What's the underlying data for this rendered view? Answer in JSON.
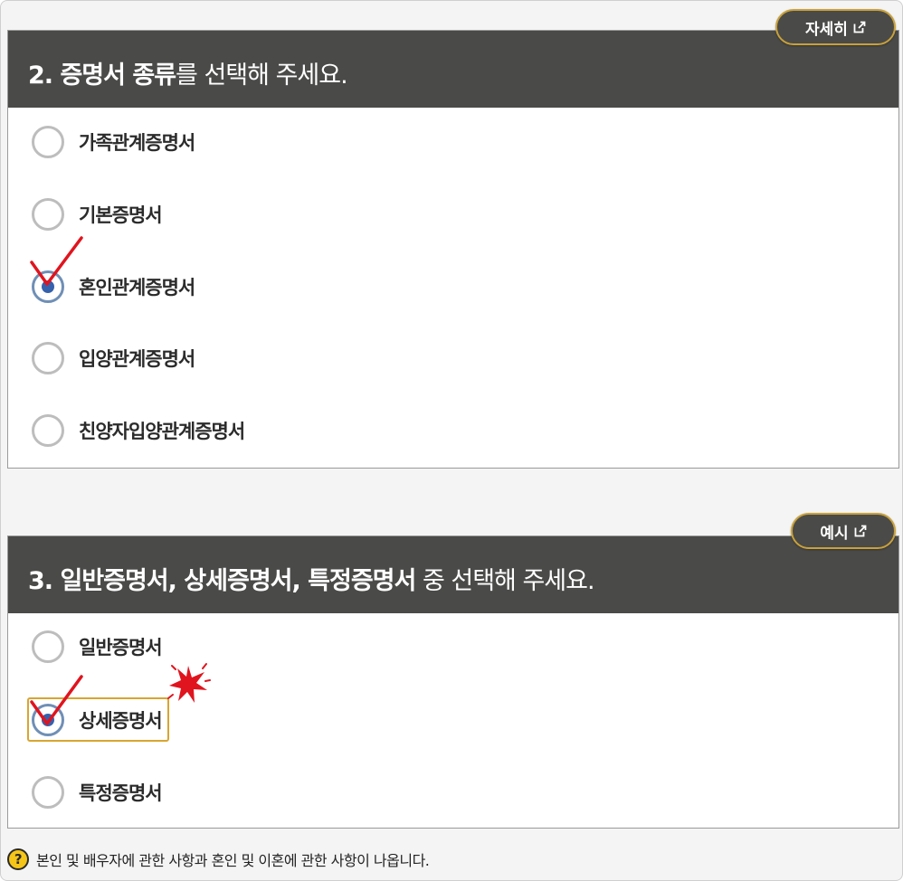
{
  "section1": {
    "title_bold": "2. 증명서 종류",
    "title_rest": "를 선택해 주세요.",
    "detail_button": "자세히",
    "options": [
      {
        "label": "가족관계증명서",
        "checked": false
      },
      {
        "label": "기본증명서",
        "checked": false
      },
      {
        "label": "혼인관계증명서",
        "checked": true
      },
      {
        "label": "입양관계증명서",
        "checked": false
      },
      {
        "label": "친양자입양관계증명서",
        "checked": false
      }
    ]
  },
  "section2": {
    "title_bold": "3. 일반증명서, 상세증명서, 특정증명서",
    "title_rest": " 중 선택해 주세요.",
    "example_button": "예시",
    "options": [
      {
        "label": "일반증명서",
        "checked": false
      },
      {
        "label": "상세증명서",
        "checked": true
      },
      {
        "label": "특정증명서",
        "checked": false
      }
    ]
  },
  "note": {
    "icon": "?",
    "text": "본인 및 배우자에 관한 사항과 혼인 및 이혼에 관한 사항이 나옵니다."
  },
  "colors": {
    "header_bg": "#4a4a48",
    "pill_border": "#c9a13a",
    "radio_checked": "#3561ad",
    "annotation_red": "#e0141e",
    "highlight_border": "#d8a530"
  }
}
